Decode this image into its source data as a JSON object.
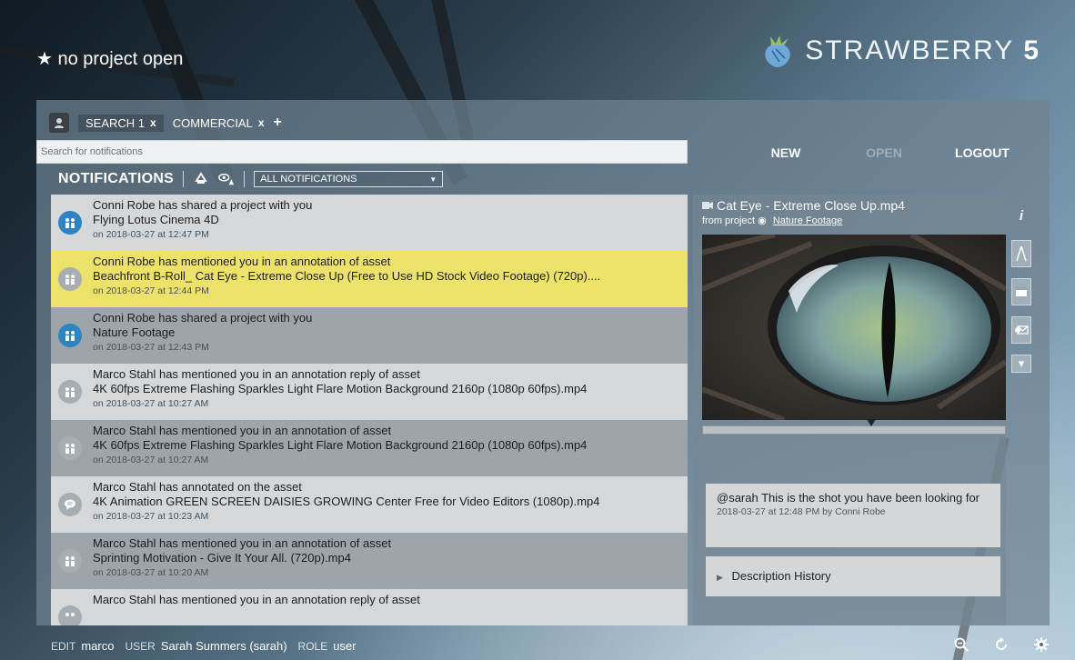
{
  "app": {
    "project_status": "no project open",
    "brand_name": "STRAWBERRY",
    "brand_version": "5"
  },
  "tabs": [
    {
      "label": "SEARCH 1",
      "close": "x"
    },
    {
      "label": "COMMERCIAL",
      "close": "x"
    }
  ],
  "tab_add": "+",
  "search": {
    "placeholder": "Search for notifications"
  },
  "actions": {
    "new": "NEW",
    "open": "OPEN",
    "logout": "LOGOUT"
  },
  "notifications_header": {
    "title": "NOTIFICATIONS",
    "filter_selected": "ALL NOTIFICATIONS"
  },
  "notifications": [
    {
      "title": "Conni Robe has shared a project with you",
      "subject": "Flying Lotus Cinema 4D",
      "timestamp": "on 2018-03-27 at 12:47 PM"
    },
    {
      "title": "Conni Robe has mentioned you in an annotation of asset",
      "subject": "Beachfront B-Roll_ Cat Eye - Extreme Close Up (Free to Use HD Stock Video Footage) (720p)....",
      "timestamp": "on 2018-03-27 at 12:44 PM"
    },
    {
      "title": "Conni Robe has shared a project with you",
      "subject": "Nature Footage",
      "timestamp": "on 2018-03-27 at 12:43 PM"
    },
    {
      "title": "Marco Stahl has mentioned you in an annotation reply of asset",
      "subject": "4K 60fps Extreme Flashing Sparkles Light Flare Motion Background 2160p (1080p 60fps).mp4",
      "timestamp": "on 2018-03-27 at 10:27 AM"
    },
    {
      "title": "Marco Stahl has mentioned you in an annotation of asset",
      "subject": "4K 60fps Extreme Flashing Sparkles Light Flare Motion Background 2160p (1080p 60fps).mp4",
      "timestamp": "on 2018-03-27 at 10:27 AM"
    },
    {
      "title": "Marco Stahl has annotated on the asset",
      "subject": "4K Animation GREEN SCREEN DAISIES GROWING Center Free for Video Editors (1080p).mp4",
      "timestamp": "on 2018-03-27 at 10:23 AM"
    },
    {
      "title": "Marco Stahl has mentioned you in an annotation of asset",
      "subject": "Sprinting Motivation - Give It Your All. (720p).mp4",
      "timestamp": "on 2018-03-27 at 10:20 AM"
    },
    {
      "title": "Marco Stahl has mentioned you in an annotation reply of asset",
      "subject": "",
      "timestamp": ""
    }
  ],
  "detail": {
    "asset_title": "Cat Eye - Extreme Close Up.mp4",
    "from_label": "from project",
    "project_name": "Nature Footage",
    "comment_text": "@sarah This is the shot you have been looking for",
    "comment_meta": "2018-03-27 at 12:48 PM by Conni Robe",
    "description_history": "Description History"
  },
  "footer": {
    "edit_label": "EDIT",
    "edit_value": "marco",
    "user_label": "USER",
    "user_value": "Sarah Summers (sarah)",
    "role_label": "ROLE",
    "role_value": "user"
  },
  "colors": {
    "highlight": "#ece26a",
    "avatar_blue": "#2c85c0",
    "avatar_grey": "#a8adb1"
  }
}
